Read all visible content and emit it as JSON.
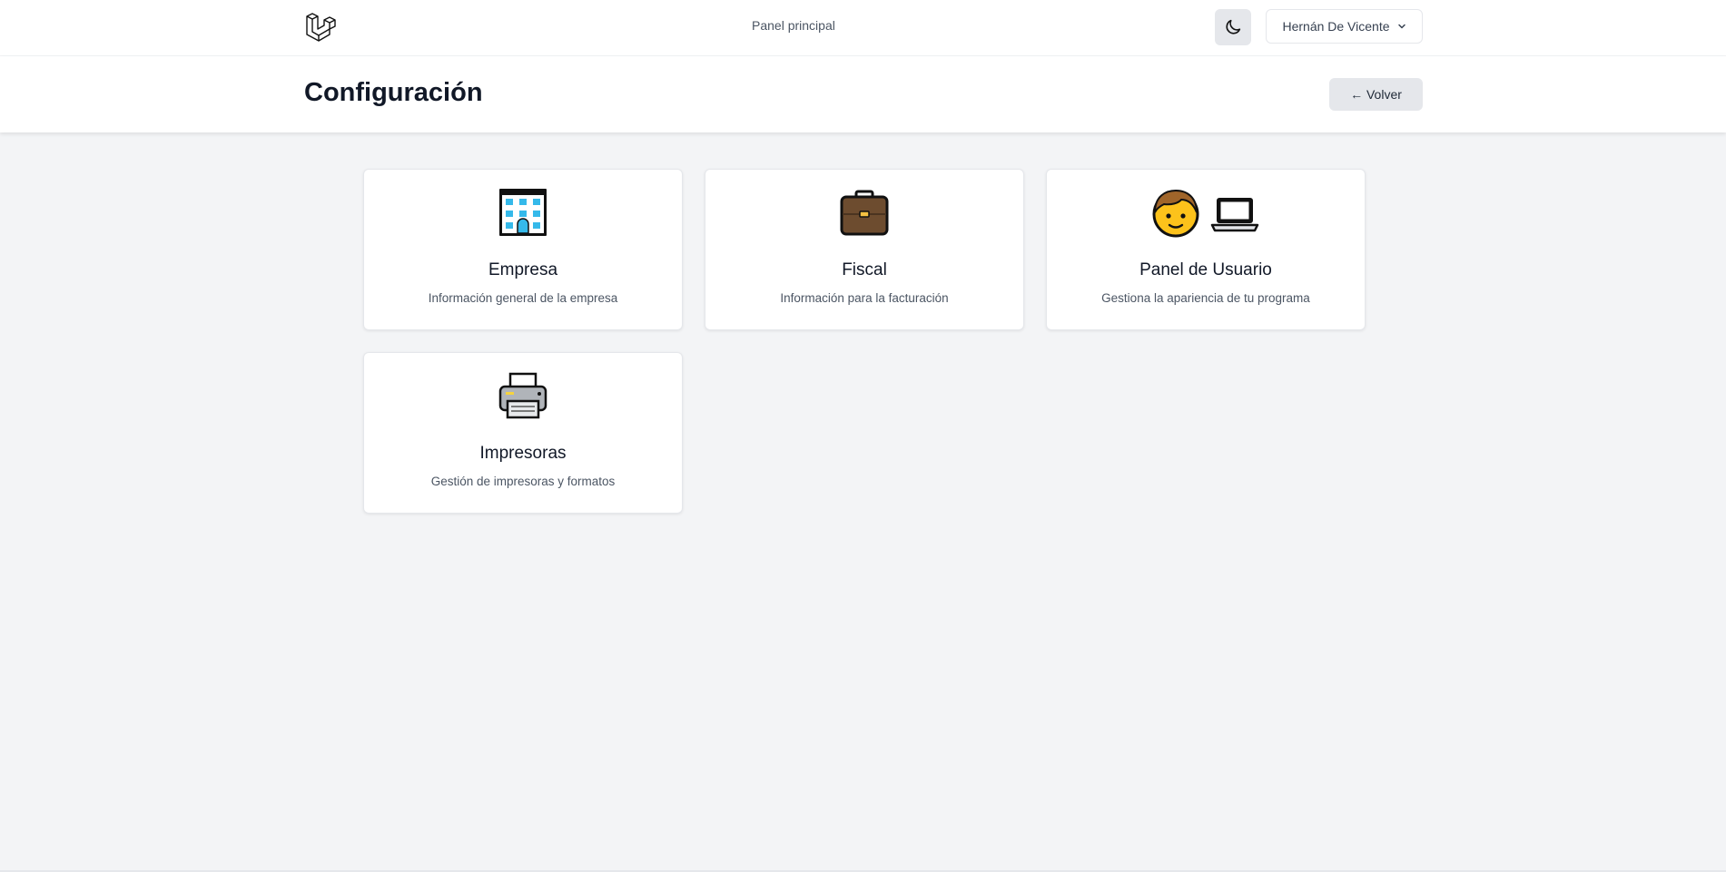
{
  "nav": {
    "link": "Panel principal",
    "user": "Hernán De Vicente"
  },
  "header": {
    "title": "Configuración",
    "back_label": "← Volver"
  },
  "cards": [
    {
      "title": "Empresa",
      "desc": "Información general de la empresa",
      "icons": [
        "office-building-icon"
      ]
    },
    {
      "title": "Fiscal",
      "desc": "Información para la facturación",
      "icons": [
        "briefcase-icon"
      ]
    },
    {
      "title": "Panel de Usuario",
      "desc": "Gestiona la apariencia de tu programa",
      "icons": [
        "boy-face-icon",
        "laptop-icon"
      ]
    },
    {
      "title": "Impresoras",
      "desc": "Gestión de impresoras y formatos",
      "icons": [
        "printer-icon"
      ]
    }
  ],
  "colors": {
    "background": "#f3f4f6",
    "surface": "#ffffff",
    "button_gray": "#e5e7eb"
  }
}
